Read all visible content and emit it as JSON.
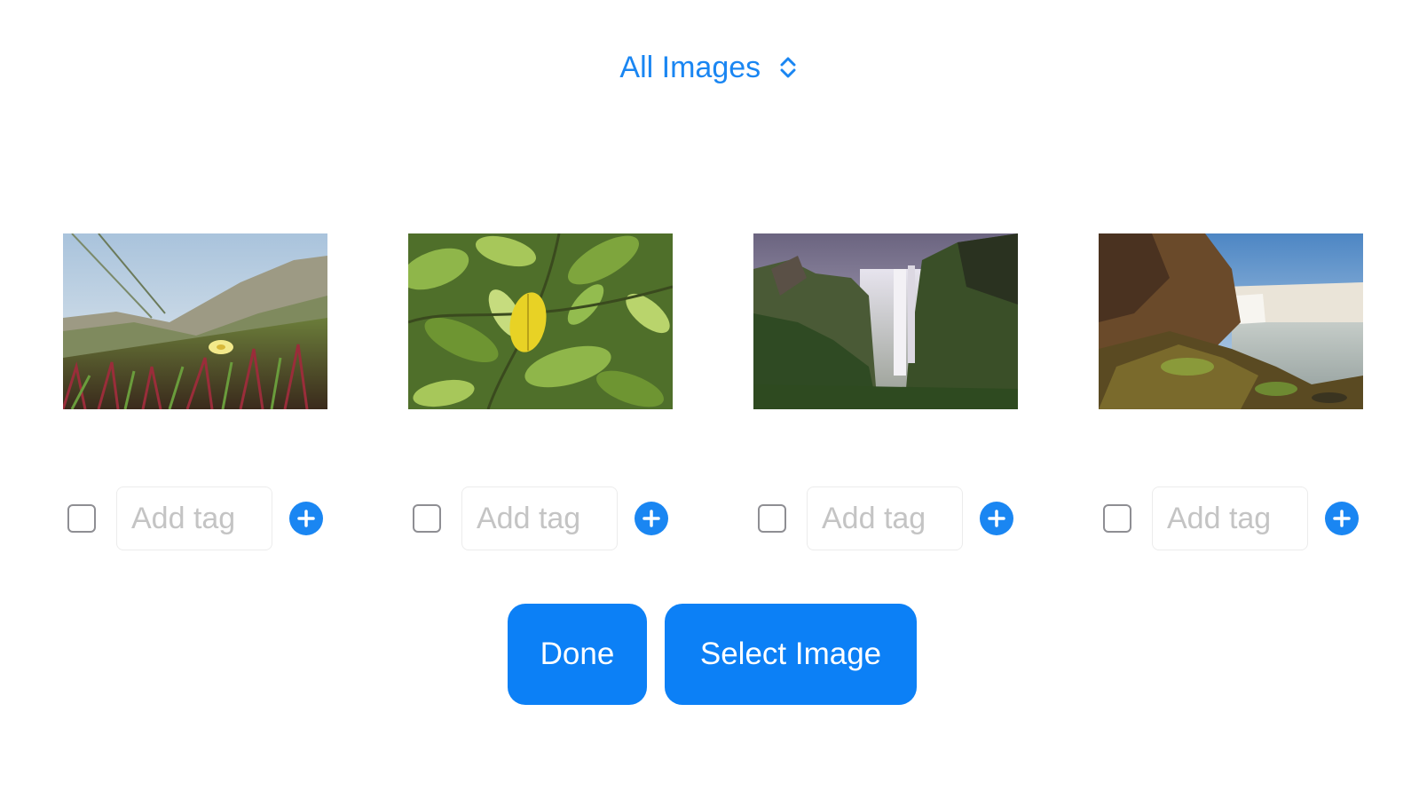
{
  "header": {
    "filter_label": "All Images",
    "filter_icon": "chevron-up-down-icon",
    "accent_color": "#1a86f2"
  },
  "images": [
    {
      "subject": "coastal dune with small yellow flower",
      "checked": false,
      "tag_value": "",
      "tag_placeholder": "Add tag",
      "add_icon": "plus-circle-icon"
    },
    {
      "subject": "green leaves with yellow leaf",
      "checked": false,
      "tag_value": "",
      "tag_placeholder": "Add tag",
      "add_icon": "plus-circle-icon"
    },
    {
      "subject": "waterfall in misty green canyon",
      "checked": false,
      "tag_value": "",
      "tag_placeholder": "Add tag",
      "add_icon": "plus-circle-icon"
    },
    {
      "subject": "waterfall beside rocky cliff",
      "checked": false,
      "tag_value": "",
      "tag_placeholder": "Add tag",
      "add_icon": "plus-circle-icon"
    }
  ],
  "actions": {
    "done_label": "Done",
    "select_label": "Select Image",
    "button_color": "#0c80f6"
  }
}
